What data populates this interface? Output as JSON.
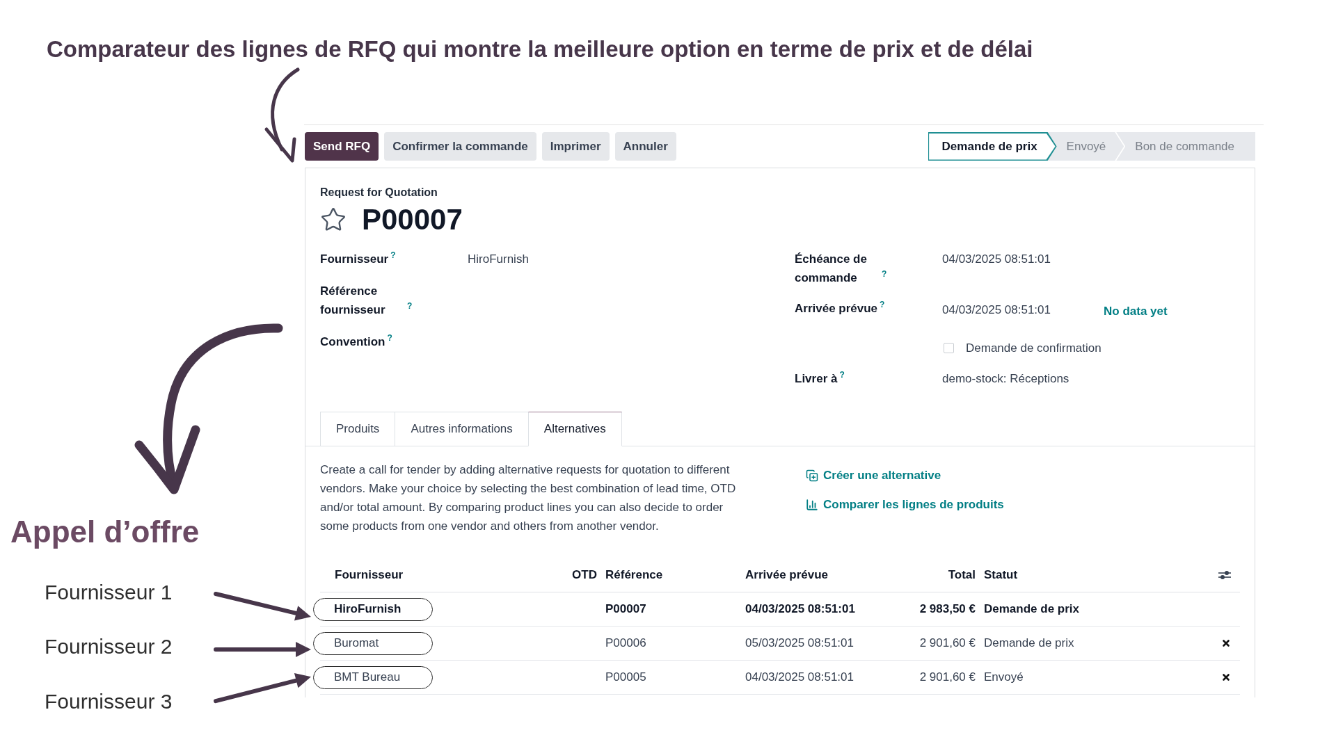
{
  "annotations": {
    "headline": "Comparateur des lignes de RFQ qui montre la meilleure option en terme de prix et de délai",
    "callout": "Appel d’offre",
    "supplier_labels": [
      "Fournisseur 1",
      "Fournisseur 2",
      "Fournisseur 3"
    ]
  },
  "actions": [
    {
      "label": "Send RFQ",
      "primary": true
    },
    {
      "label": "Confirmer la commande",
      "primary": false
    },
    {
      "label": "Imprimer",
      "primary": false
    },
    {
      "label": "Annuler",
      "primary": false
    }
  ],
  "status_steps": [
    {
      "label": "Demande de prix",
      "selected": true
    },
    {
      "label": "Envoyé",
      "selected": false
    },
    {
      "label": "Bon de commande",
      "selected": false
    }
  ],
  "record": {
    "kind_label": "Request for Quotation",
    "name": "P00007",
    "starred": false
  },
  "fields_left": [
    {
      "label": "Fournisseur",
      "hint": "?",
      "value": "HiroFurnish"
    },
    {
      "label": "Référence fournisseur",
      "hint": "?"
    },
    {
      "label": "Convention",
      "hint": "?"
    }
  ],
  "fields_right": [
    {
      "kind": "field",
      "label": "Échéance de commande",
      "hint": "?",
      "value": "04/03/2025 08:51:01"
    },
    {
      "kind": "field",
      "label": "Arrivée prévue",
      "hint": "?",
      "value": "04/03/2025 08:51:01",
      "extra": "No data yet"
    },
    {
      "kind": "checkbox",
      "label": "Demande de confirmation",
      "checked": false
    },
    {
      "kind": "field",
      "label": "Livrer à",
      "hint": "?",
      "value": "demo-stock: Réceptions"
    }
  ],
  "tabs": [
    {
      "label": "Produits",
      "selected": false
    },
    {
      "label": "Autres informations",
      "selected": false
    },
    {
      "label": "Alternatives",
      "selected": true
    }
  ],
  "alternatives": {
    "description": "Create a call for tender by adding alternative requests for quotation to different vendors. Make your choice by selecting the best combination of lead time, OTD and/or total amount. By comparing product lines you can also decide to order some products from one vendor and others from another vendor.",
    "links": [
      {
        "kind": "create",
        "label": "Créer une alternative"
      },
      {
        "kind": "compare",
        "label": "Comparer les lignes de produits"
      }
    ],
    "table": {
      "columns": [
        "Fournisseur",
        "OTD",
        "Référence",
        "Arrivée prévue",
        "Total",
        "Statut"
      ],
      "rows": [
        {
          "supplier": "HiroFurnish",
          "reference": "P00007",
          "arrival": "04/03/2025 08:51:01",
          "total": "2 983,50 €",
          "status": "Demande de prix",
          "current": true
        },
        {
          "supplier": "Buromat",
          "reference": "P00006",
          "arrival": "05/03/2025 08:51:01",
          "total": "2 901,60 €",
          "status": "Demande de prix",
          "current": false
        },
        {
          "supplier": "BMT Bureau",
          "reference": "P00005",
          "arrival": "04/03/2025 08:51:01",
          "total": "2 901,60 €",
          "status": "Envoyé",
          "current": false
        }
      ]
    }
  }
}
